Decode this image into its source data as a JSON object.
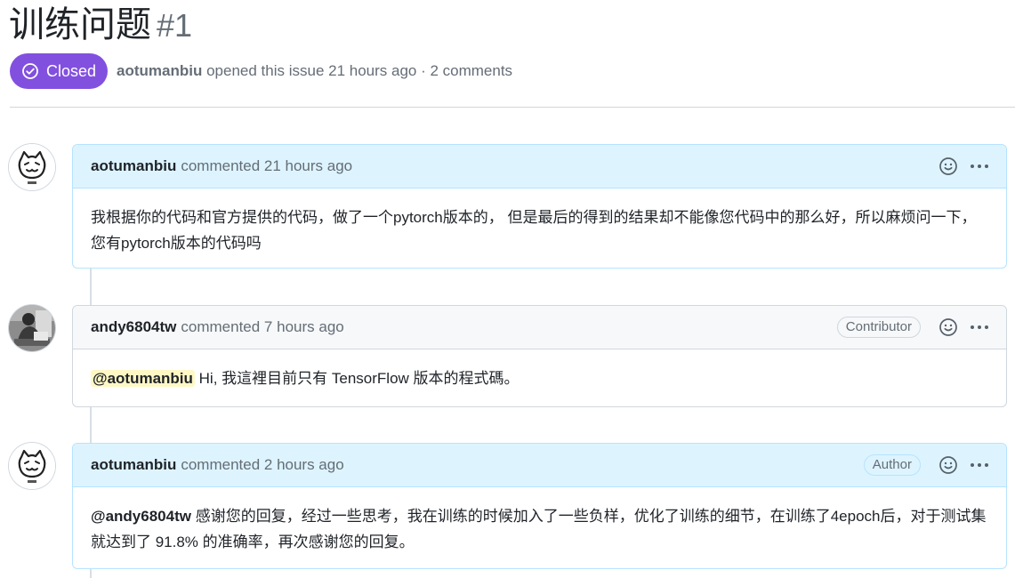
{
  "issue": {
    "title": "训练问题",
    "number": "#1",
    "state_label": "Closed",
    "state_color": "#8250df",
    "author": "aotumanbiu",
    "meta_text": "opened this issue 21 hours ago · 2 comments"
  },
  "comments": [
    {
      "author": "aotumanbiu",
      "action": "commented 21 hours ago",
      "body": "我根据你的代码和官方提供的代码，做了一个pytorch版本的， 但是最后的得到的结果却不能像您代码中的那么好，所以麻烦问一下，您有pytorch版本的代码吗"
    },
    {
      "author": "andy6804tw",
      "action": "commented 7 hours ago",
      "badge": "Contributor",
      "mention": "@aotumanbiu",
      "body": "Hi, 我這裡目前只有 TensorFlow 版本的程式碼。"
    },
    {
      "author": "aotumanbiu",
      "action": "commented 2 hours ago",
      "badge": "Author",
      "mention": "@andy6804tw",
      "body": "感谢您的回复，经过一些思考，我在训练的时候加入了一些负样，优化了训练的细节，在训练了4epoch后，对于测试集就达到了 91.8% 的准确率，再次感谢您的回复。"
    }
  ],
  "icons": {
    "state": "check-circle-icon",
    "reaction": "smiley-icon",
    "menu": "kebab-horizontal-icon"
  }
}
